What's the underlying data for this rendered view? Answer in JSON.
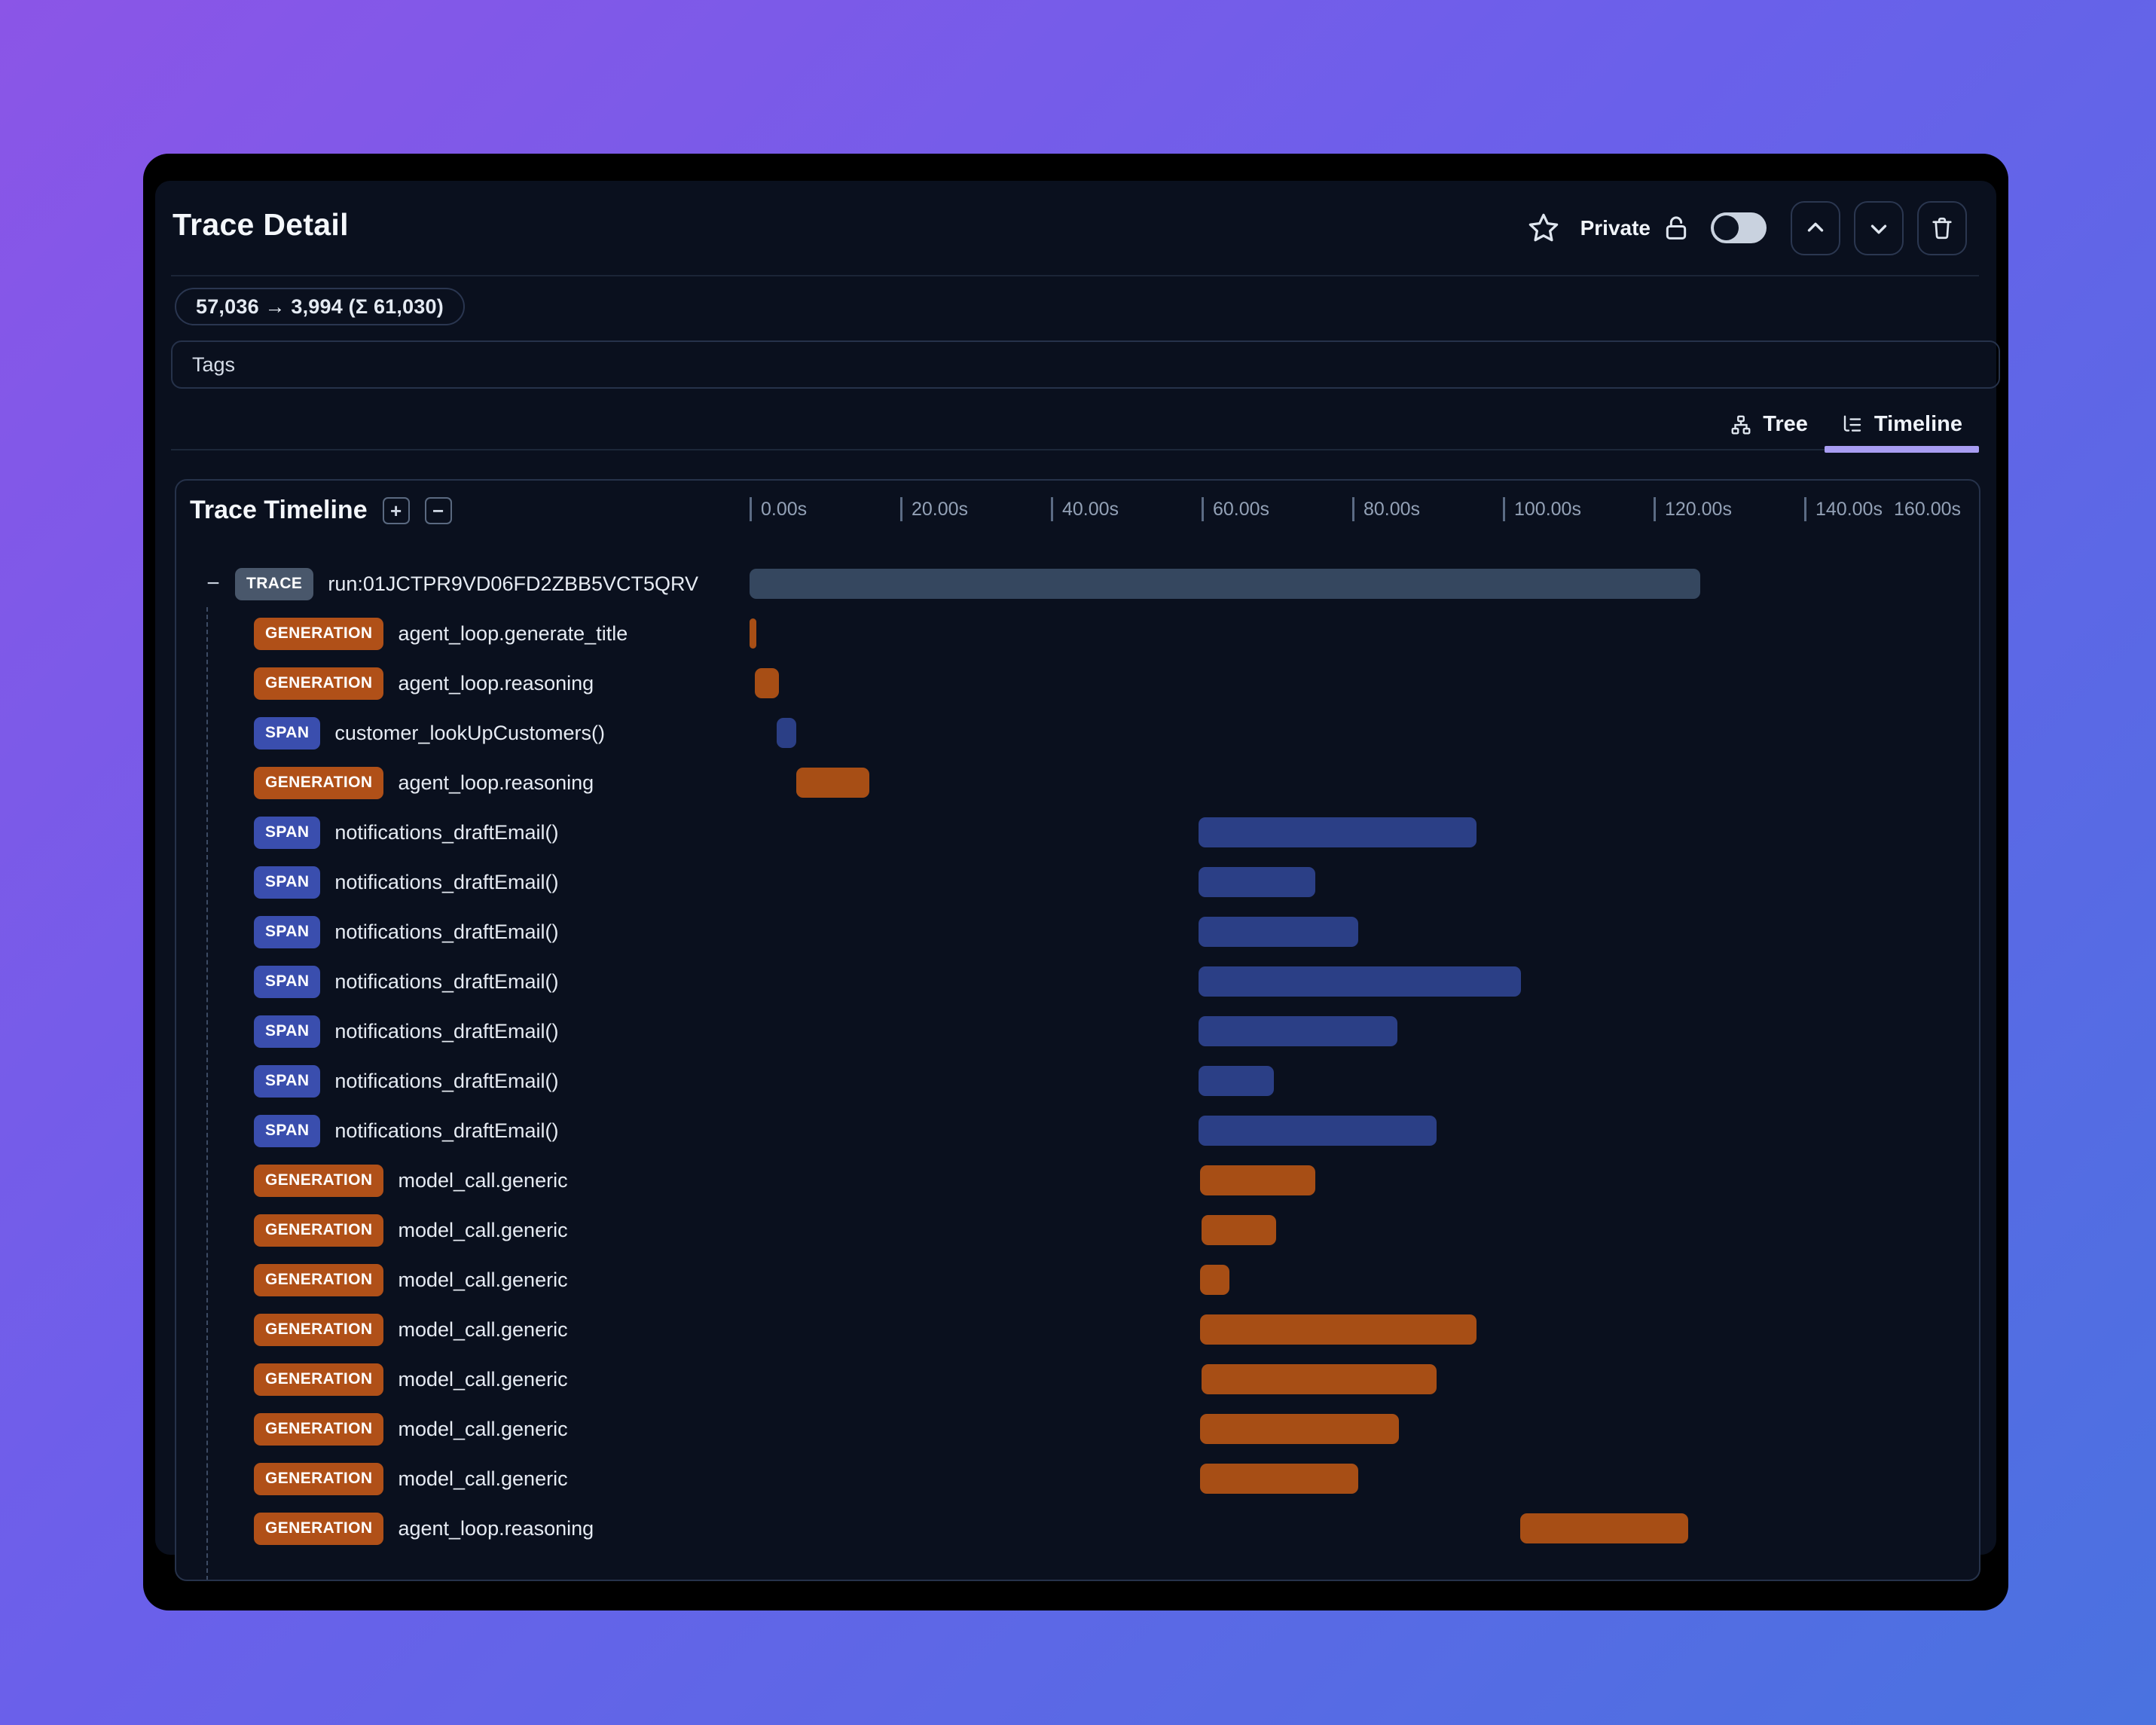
{
  "header": {
    "title": "Trace Detail",
    "privacy_label": "Private",
    "privacy_toggle_on": false
  },
  "token_usage": {
    "text": "57,036 → 3,994 (Σ 61,030)",
    "input_tokens": "57,036",
    "output_tokens": "3,994",
    "total_tokens": "61,030"
  },
  "tags": {
    "label": "Tags"
  },
  "view_tabs": {
    "items": [
      {
        "label": "Tree",
        "icon": "tree-icon",
        "active": false
      },
      {
        "label": "Timeline",
        "icon": "timeline-icon",
        "active": true
      }
    ]
  },
  "timeline": {
    "title": "Trace Timeline",
    "expand_all_glyph": "+",
    "collapse_all_glyph": "−",
    "collapse_row_glyph": "−",
    "axis": {
      "tick_labels": [
        "0.00s",
        "20.00s",
        "40.00s",
        "60.00s",
        "80.00s",
        "100.00s",
        "120.00s",
        "140.00s"
      ],
      "end_label": "160.00s",
      "tick_interval_seconds": 20,
      "max_seconds": 160
    },
    "rows": [
      {
        "type": "TRACE",
        "name": "run:01JCTPR9VD06FD2ZBB5VCT5QRV",
        "start_s": 0,
        "end_s": 126.2,
        "level": 0,
        "collapsible": true
      },
      {
        "type": "GENERATION",
        "name": "agent_loop.generate_title",
        "start_s": 0,
        "end_s": 0.9,
        "level": 1
      },
      {
        "type": "GENERATION",
        "name": "agent_loop.reasoning",
        "start_s": 0.7,
        "end_s": 3.9,
        "level": 1
      },
      {
        "type": "SPAN",
        "name": "customer_lookUpCustomers()",
        "start_s": 3.6,
        "end_s": 6.2,
        "level": 1
      },
      {
        "type": "GENERATION",
        "name": "agent_loop.reasoning",
        "start_s": 6.2,
        "end_s": 15.9,
        "level": 1
      },
      {
        "type": "SPAN",
        "name": "notifications_draftEmail()",
        "start_s": 59.6,
        "end_s": 96.5,
        "level": 1
      },
      {
        "type": "SPAN",
        "name": "notifications_draftEmail()",
        "start_s": 59.6,
        "end_s": 75.1,
        "level": 1
      },
      {
        "type": "SPAN",
        "name": "notifications_draftEmail()",
        "start_s": 59.6,
        "end_s": 80.8,
        "level": 1
      },
      {
        "type": "SPAN",
        "name": "notifications_draftEmail()",
        "start_s": 59.6,
        "end_s": 102.4,
        "level": 1
      },
      {
        "type": "SPAN",
        "name": "notifications_draftEmail()",
        "start_s": 59.6,
        "end_s": 86.0,
        "level": 1
      },
      {
        "type": "SPAN",
        "name": "notifications_draftEmail()",
        "start_s": 59.6,
        "end_s": 69.6,
        "level": 1
      },
      {
        "type": "SPAN",
        "name": "notifications_draftEmail()",
        "start_s": 59.6,
        "end_s": 91.2,
        "level": 1
      },
      {
        "type": "GENERATION",
        "name": "model_call.generic",
        "start_s": 59.8,
        "end_s": 75.1,
        "level": 1
      },
      {
        "type": "GENERATION",
        "name": "model_call.generic",
        "start_s": 60.0,
        "end_s": 69.9,
        "level": 1
      },
      {
        "type": "GENERATION",
        "name": "model_call.generic",
        "start_s": 59.8,
        "end_s": 63.7,
        "level": 1
      },
      {
        "type": "GENERATION",
        "name": "model_call.generic",
        "start_s": 59.8,
        "end_s": 96.5,
        "level": 1
      },
      {
        "type": "GENERATION",
        "name": "model_call.generic",
        "start_s": 60.0,
        "end_s": 91.2,
        "level": 1
      },
      {
        "type": "GENERATION",
        "name": "model_call.generic",
        "start_s": 59.8,
        "end_s": 86.2,
        "level": 1
      },
      {
        "type": "GENERATION",
        "name": "model_call.generic",
        "start_s": 59.8,
        "end_s": 80.8,
        "level": 1
      },
      {
        "type": "GENERATION",
        "name": "agent_loop.reasoning",
        "start_s": 102.3,
        "end_s": 124.6,
        "level": 1
      }
    ]
  },
  "colors": {
    "background_gradient": [
      "#8b55e7",
      "#4a72e0"
    ],
    "window_frame": "#000000",
    "panel": "#0a101e",
    "border": "#26324a",
    "tab_active_underline": "#a89df2",
    "toggle_track_off": "#c9d2df",
    "types": {
      "TRACE": {
        "badge": "#49576b",
        "bar": "#35475f"
      },
      "GENERATION": {
        "badge": "#b05018",
        "bar": "#a74e15"
      },
      "SPAN": {
        "badge": "#3a4eae",
        "bar": "#2b3f86"
      }
    }
  }
}
